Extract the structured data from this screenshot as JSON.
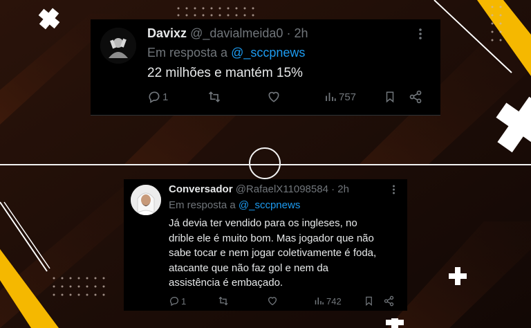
{
  "tweet1": {
    "display_name": "Davixz",
    "handle": "@_davialmeida0",
    "separator": "·",
    "time": "2h",
    "reply_prefix": "Em resposta a",
    "reply_to": "@_sccpnews",
    "text": "22 milhões e mantém 15%",
    "replies": "1",
    "views": "757"
  },
  "tweet2": {
    "display_name": "Conversador",
    "handle": "@RafaelX11098584",
    "separator": "·",
    "time": "2h",
    "reply_prefix": "Em resposta a",
    "reply_to": "@_sccpnews",
    "text_lines": [
      "Já devia ter vendido para os ingleses, no",
      "drible ele é muito bom. Mas jogador que não",
      "sabe tocar e nem jogar coletivamente é foda,",
      "atacante que não faz gol e nem da",
      "assistência é embaçado."
    ],
    "replies": "1",
    "views": "742"
  },
  "colors": {
    "background": "#1a0d08",
    "accent_yellow": "#f5b800",
    "link_blue": "#1d9bf0",
    "muted_gray": "#71767b",
    "text": "#e7e9ea"
  },
  "icons": [
    "reply-icon",
    "retweet-icon",
    "like-icon",
    "views-icon",
    "bookmark-icon",
    "share-icon",
    "more-icon"
  ]
}
